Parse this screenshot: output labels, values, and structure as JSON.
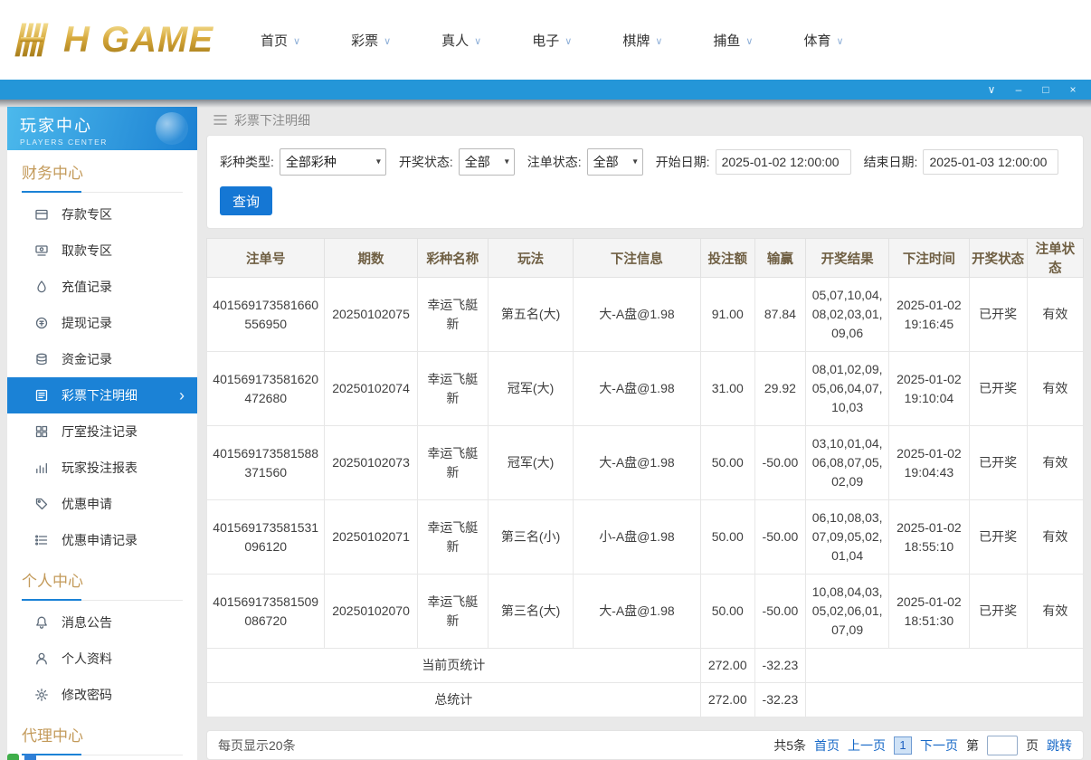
{
  "topnav": {
    "logo_text": "H GAME",
    "items": [
      {
        "label": "首页"
      },
      {
        "label": "彩票"
      },
      {
        "label": "真人"
      },
      {
        "label": "电子"
      },
      {
        "label": "棋牌"
      },
      {
        "label": "捕鱼"
      },
      {
        "label": "体育"
      }
    ]
  },
  "titlebar": {
    "controls": [
      "menu",
      "minimize",
      "maximize",
      "close"
    ]
  },
  "sidebar": {
    "title": "玩家中心",
    "subtitle": "PLAYERS CENTER",
    "sections": [
      {
        "label": "财务中心",
        "items": [
          {
            "label": "存款专区",
            "icon": "deposit-card-icon"
          },
          {
            "label": "取款专区",
            "icon": "withdraw-icon"
          },
          {
            "label": "充值记录",
            "icon": "recharge-record-icon"
          },
          {
            "label": "提现记录",
            "icon": "withdrawal-record-icon"
          },
          {
            "label": "资金记录",
            "icon": "funds-record-icon"
          },
          {
            "label": "彩票下注明细",
            "icon": "lottery-bets-icon",
            "active": true
          },
          {
            "label": "厅室投注记录",
            "icon": "hall-bets-icon"
          },
          {
            "label": "玩家投注报表",
            "icon": "player-report-icon"
          },
          {
            "label": "优惠申请",
            "icon": "promo-apply-icon"
          },
          {
            "label": "优惠申请记录",
            "icon": "promo-record-icon"
          }
        ]
      },
      {
        "label": "个人中心",
        "items": [
          {
            "label": "消息公告",
            "icon": "bell-icon"
          },
          {
            "label": "个人资料",
            "icon": "person-icon"
          },
          {
            "label": "修改密码",
            "icon": "gear-icon"
          }
        ]
      },
      {
        "label": "代理中心",
        "items": []
      }
    ]
  },
  "main": {
    "breadcrumb": "彩票下注明细",
    "filters": {
      "lottery_type_label": "彩种类型:",
      "lottery_type_value": "全部彩种",
      "draw_status_label": "开奖状态:",
      "draw_status_value": "全部",
      "order_status_label": "注单状态:",
      "order_status_value": "全部",
      "start_date_label": "开始日期:",
      "start_date_value": "2025-01-02 12:00:00",
      "end_date_label": "结束日期:",
      "end_date_value": "2025-01-03 12:00:00",
      "search_button": "查询"
    },
    "table": {
      "headers": [
        "注单号",
        "期数",
        "彩种名称",
        "玩法",
        "下注信息",
        "投注额",
        "输赢",
        "开奖结果",
        "下注时间",
        "开奖状态",
        "注单状态"
      ],
      "rows": [
        [
          "401569173581660556950",
          "20250102075",
          "幸运飞艇新",
          "第五名(大)",
          "大-A盘@1.98",
          "91.00",
          "87.84",
          "05,07,10,04,08,02,03,01,09,06",
          "2025-01-02 19:16:45",
          "已开奖",
          "有效"
        ],
        [
          "401569173581620472680",
          "20250102074",
          "幸运飞艇新",
          "冠军(大)",
          "大-A盘@1.98",
          "31.00",
          "29.92",
          "08,01,02,09,05,06,04,07,10,03",
          "2025-01-02 19:10:04",
          "已开奖",
          "有效"
        ],
        [
          "401569173581588371560",
          "20250102073",
          "幸运飞艇新",
          "冠军(大)",
          "大-A盘@1.98",
          "50.00",
          "-50.00",
          "03,10,01,04,06,08,07,05,02,09",
          "2025-01-02 19:04:43",
          "已开奖",
          "有效"
        ],
        [
          "401569173581531096120",
          "20250102071",
          "幸运飞艇新",
          "第三名(小)",
          "小-A盘@1.98",
          "50.00",
          "-50.00",
          "06,10,08,03,07,09,05,02,01,04",
          "2025-01-02 18:55:10",
          "已开奖",
          "有效"
        ],
        [
          "401569173581509086720",
          "20250102070",
          "幸运飞艇新",
          "第三名(大)",
          "大-A盘@1.98",
          "50.00",
          "-50.00",
          "10,08,04,03,05,02,06,01,07,09",
          "2025-01-02 18:51:30",
          "已开奖",
          "有效"
        ]
      ],
      "summary_rows": [
        {
          "label": "当前页统计",
          "bet_total": "272.00",
          "win_loss": "-32.23"
        },
        {
          "label": "总统计",
          "bet_total": "272.00",
          "win_loss": "-32.23"
        }
      ]
    },
    "pagination": {
      "page_size_text": "每页显示20条",
      "total_text": "共5条",
      "first": "首页",
      "prev": "上一页",
      "current_page": "1",
      "next": "下一页",
      "jump_prefix": "第",
      "jump_suffix": "页",
      "jump_button": "跳转"
    }
  },
  "colors": {
    "accent_blue": "#1b82d6",
    "titlebar_blue": "#2496d8",
    "gold": "#c39a5a",
    "link_blue": "#1668c7"
  }
}
